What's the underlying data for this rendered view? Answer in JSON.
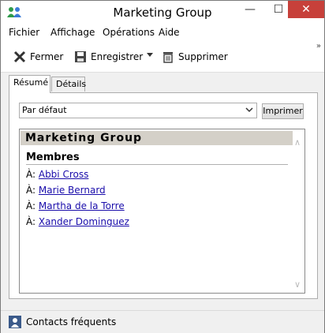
{
  "window": {
    "title": "Marketing Group"
  },
  "titlebar": {
    "minimize": "—",
    "maximize": "☐",
    "close": "✕"
  },
  "menu": [
    "Fichier",
    "Affichage",
    "Opérations",
    "Aide"
  ],
  "toolbar": {
    "close_label": "Fermer",
    "save_label": "Enregistrer",
    "delete_label": "Supprimer",
    "overflow": "»"
  },
  "tabs": [
    "Résumé",
    "Détails"
  ],
  "view_select": {
    "value": "Par défaut",
    "arrow": "⌄"
  },
  "print_button": "Imprimer",
  "contact": {
    "name": "Marketing Group",
    "section": "Membres",
    "prefix": "À: ",
    "members": [
      "Abbi Cross",
      "Marie Bernard",
      "Martha de la Torre",
      "Xander Dominguez"
    ]
  },
  "scroll": {
    "up": "∧",
    "down": "∨"
  },
  "status": {
    "text": "Contacts fréquents"
  }
}
